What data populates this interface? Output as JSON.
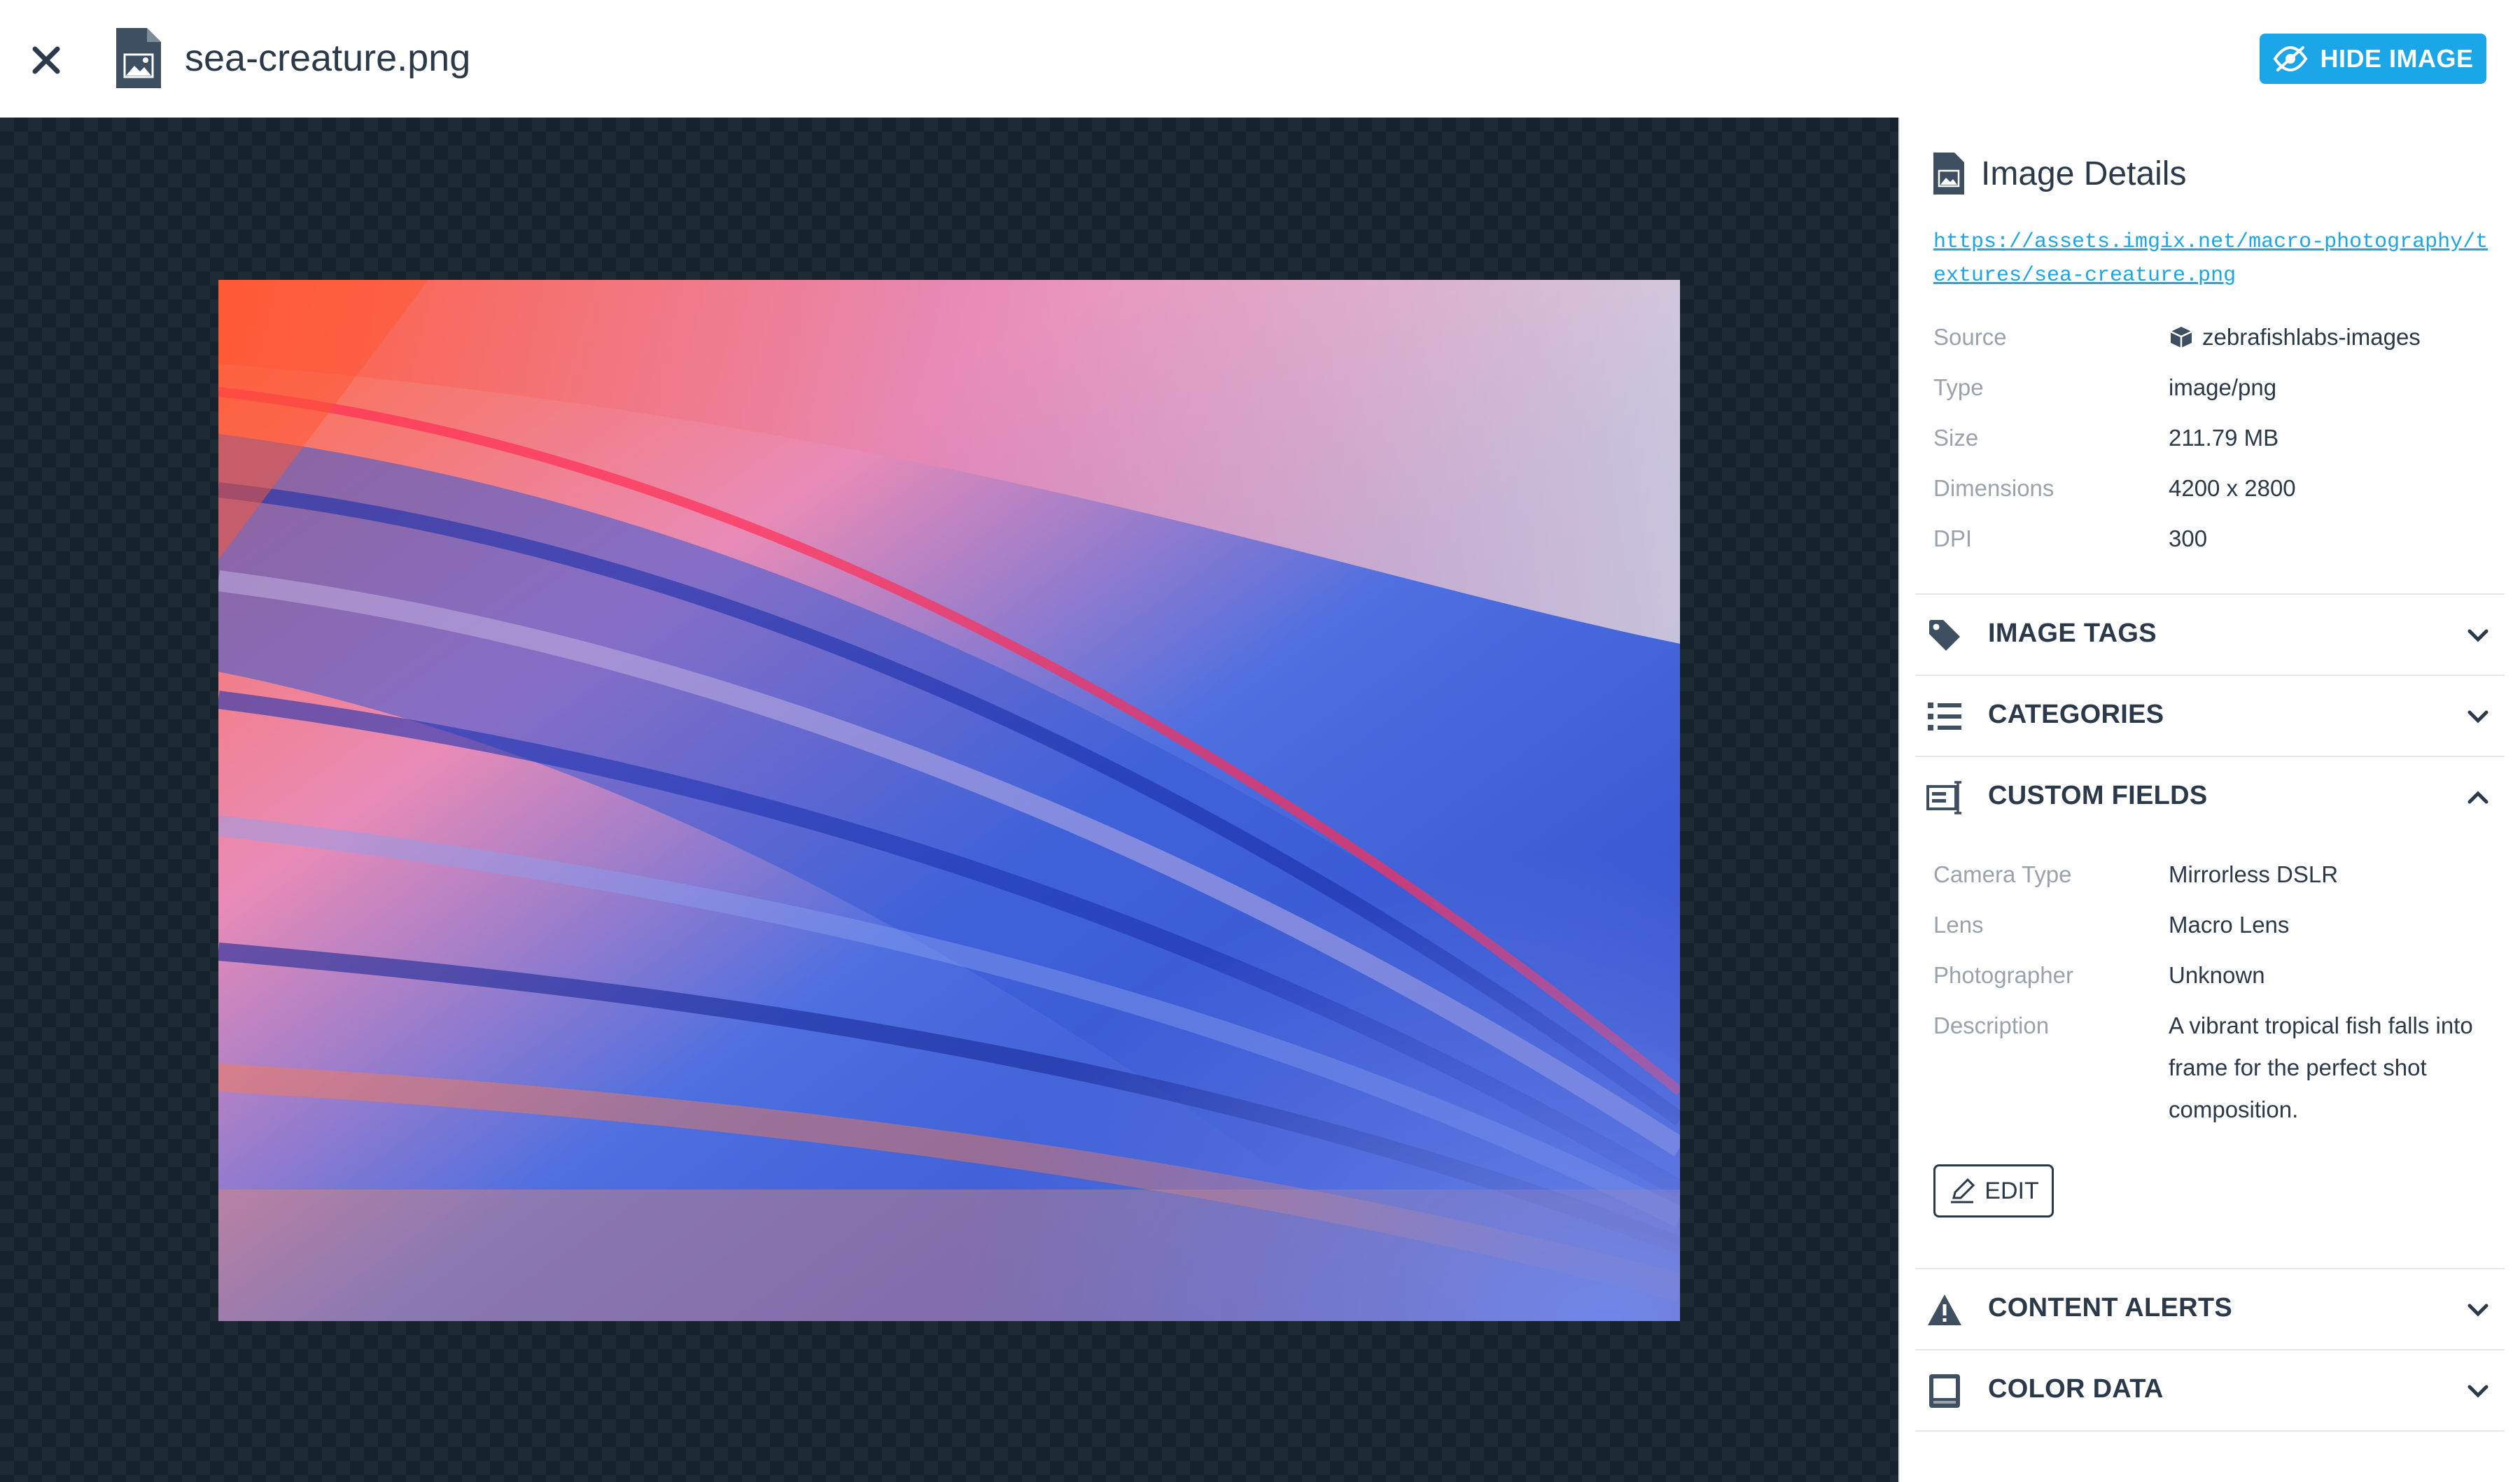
{
  "header": {
    "file_name": "sea-creature.png",
    "hide_button_label": "HIDE IMAGE",
    "accent_color": "#1aa6e8"
  },
  "details": {
    "title": "Image Details",
    "url": "https://assets.imgix.net/macro-photography/textures/sea-creature.png",
    "rows": [
      {
        "key": "Source",
        "value": "zebrafishlabs-images",
        "icon": "box-icon"
      },
      {
        "key": "Type",
        "value": "image/png"
      },
      {
        "key": "Size",
        "value": "211.79 MB"
      },
      {
        "key": "Dimensions",
        "value": "4200 x 2800"
      },
      {
        "key": "DPI",
        "value": "300"
      }
    ]
  },
  "sections": {
    "image_tags": {
      "label": "IMAGE TAGS",
      "icon": "tag-icon",
      "expanded": false
    },
    "categories": {
      "label": "CATEGORIES",
      "icon": "list-icon",
      "expanded": false
    },
    "custom_fields": {
      "label": "CUSTOM FIELDS",
      "icon": "form-icon",
      "expanded": true
    },
    "content_alerts": {
      "label": "CONTENT ALERTS",
      "icon": "warning-icon",
      "expanded": false
    },
    "color_data": {
      "label": "COLOR DATA",
      "icon": "palette-icon",
      "expanded": false
    }
  },
  "custom_fields": {
    "rows": [
      {
        "key": "Camera Type",
        "value": "Mirrorless DSLR"
      },
      {
        "key": "Lens",
        "value": "Macro Lens"
      },
      {
        "key": "Photographer",
        "value": "Unknown"
      },
      {
        "key": "Description",
        "value": "A vibrant tropical fish falls into frame for the perfect shot composition."
      }
    ],
    "edit_label": "EDIT"
  }
}
